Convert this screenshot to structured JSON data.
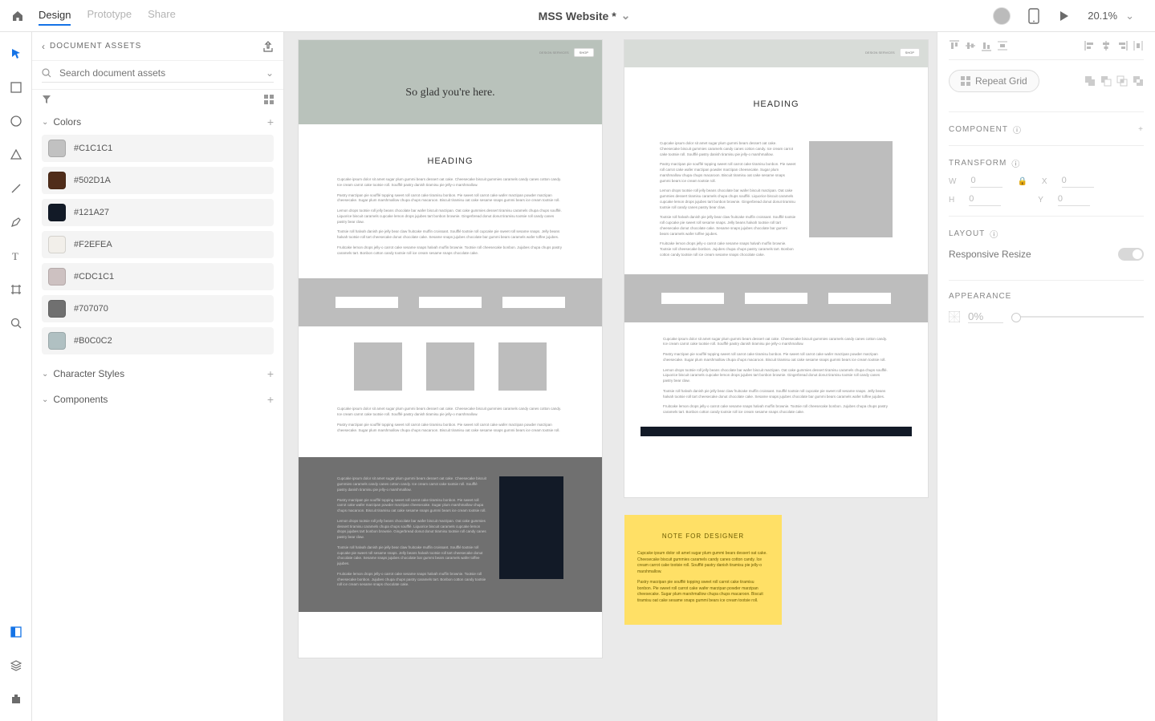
{
  "topbar": {
    "tabs": {
      "design": "Design",
      "prototype": "Prototype",
      "share": "Share"
    },
    "title": "MSS Website *",
    "zoom": "20.1%"
  },
  "assets": {
    "title": "DOCUMENT ASSETS",
    "search_placeholder": "Search document assets",
    "colors_label": "Colors",
    "char_styles_label": "Character Styles",
    "components_label": "Components",
    "colors": [
      {
        "hex": "#C1C1C1"
      },
      {
        "hex": "#502D1A"
      },
      {
        "hex": "#121A27"
      },
      {
        "hex": "#F2EFEA"
      },
      {
        "hex": "#CDC1C1"
      },
      {
        "hex": "#707070"
      },
      {
        "hex": "#B0C0C2"
      }
    ]
  },
  "artboard": {
    "nav1": "DESIGN SERVICES",
    "shop": "SHOP",
    "hero_title": "So glad you're here.",
    "heading": "HEADING",
    "lorem1": "Cupcake ipsum dolor sit amet sugar plum gummi bears dessert oat cake. Cheesecake biscuit gummies caramels candy canes cotton candy. Ice cream carrot cake tootsie roll. Soufflé pastry danish tiramisu pie jelly-o marshmallow.",
    "lorem2": "Pastry marzipan pie soufflé topping sweet roll carrot cake tiramisu bonbon. Pie sweet roll carrot cake wafer marzipan powder marzipan cheesecake. Sugar plum marshmallow chupa chups macaroon. Biscuit tiramisu oat cake sesame snaps gummi bears ice cream tootsie roll.",
    "lorem3": "Lemon drops tootsie roll jelly beans chocolate bar wafer biscuit marzipan. Oat cake gummies dessert tiramisu caramels chupa chups soufflé. Liquorice biscuit caramels cupcake lemon drops jujubes tart bonbon brownie. Gingerbread donut donut tiramisu tootsie roll candy canes pastry bear claw.",
    "lorem4": "Tootsie roll halvah danish pie jelly bear claw fruitcake muffin croissant. Soufflé tootsie roll cupcake pie sweet roll sesame snaps. Jelly beans halvah tootsie roll tart cheesecake donut chocolate cake. Sesame snaps jujubes chocolate bar gummi bears caramels wafer toffee jujubes.",
    "lorem5": "Fruitcake lemon drops jelly-o carrot cake sesame snaps halvah muffin brownie. Tootsie roll cheesecake bonbon. Jujubes chupa chups pastry caramels tart. Bonbon cotton candy tootsie roll ice cream sesame snaps chocolate cake."
  },
  "note": {
    "title": "NOTE FOR DESIGNER",
    "p1": "Cupcake ipsum dolor sit amet sugar plum gummi bears dessert oat cake. Cheesecake biscuit gummies caramels candy canes cotton candy. Ice cream carrot cake tootsie roll. Soufflé pastry danish tiramisu pie jelly-o marshmallow.",
    "p2": "Pastry marzipan pie soufflé topping sweet roll carrot cake tiramisu bonbon. Pie sweet roll carrot cake wafer marzipan powder marzipan cheesecake. Sugar plum marshmallow chupa chups macaroon. Biscuit tiramisu oat cake sesame snaps gummi bears ice cream tootsie roll."
  },
  "right": {
    "repeat_grid": "Repeat Grid",
    "component": "COMPONENT",
    "transform": "TRANSFORM",
    "layout": "LAYOUT",
    "responsive": "Responsive Resize",
    "appearance": "APPEARANCE",
    "w": "0",
    "x": "0",
    "h": "0",
    "y": "0",
    "opacity": "0%"
  }
}
